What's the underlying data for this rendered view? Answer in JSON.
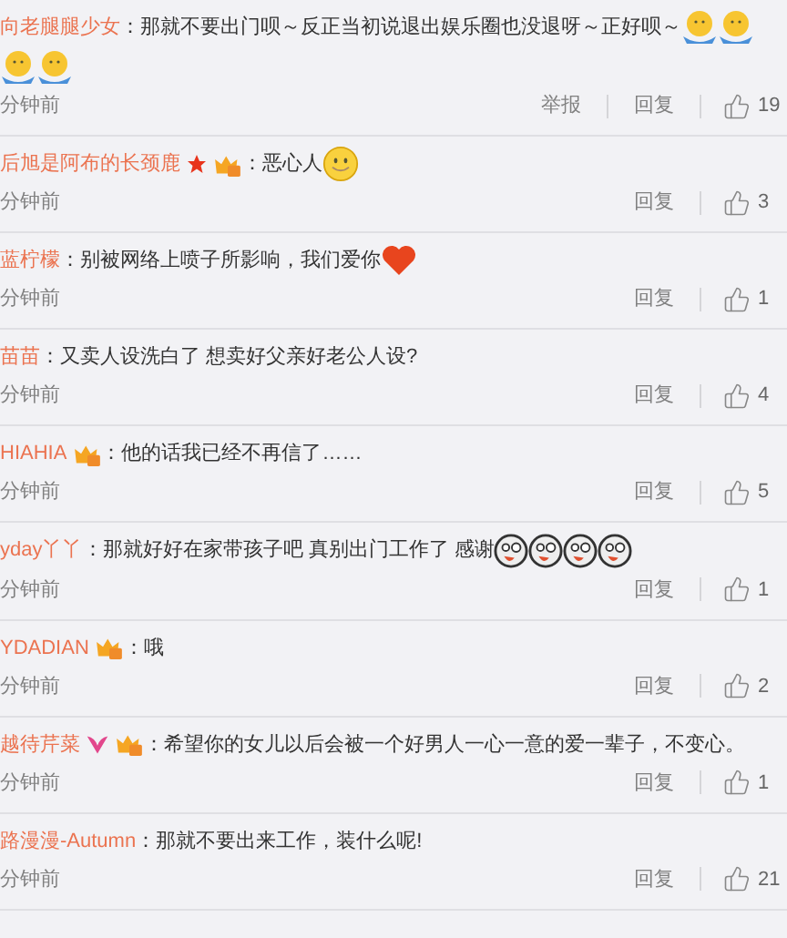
{
  "comments": [
    {
      "user": "向老腿腿少女",
      "colon": "：",
      "text": "那就不要出门呗～反正当初说退出娱乐圈也没退呀～正好呗～",
      "emojis": [
        {
          "kind": "shrug"
        },
        {
          "kind": "shrug"
        },
        {
          "kind": "shrug"
        },
        {
          "kind": "shrug"
        }
      ],
      "time": "分钟前",
      "actions": [
        "举报",
        "回复"
      ],
      "likes": "19"
    },
    {
      "user": "后旭是阿布的长颈鹿",
      "badges": [
        {
          "kind": "star"
        },
        {
          "kind": "vip"
        }
      ],
      "colon": "：",
      "text": "恶心人",
      "emojis": [
        {
          "kind": "smile"
        }
      ],
      "time": "分钟前",
      "actions": [
        "回复"
      ],
      "likes": "3"
    },
    {
      "user": "蓝柠檬",
      "colon": "：",
      "text": "别被网络上喷子所影响，我们爱你",
      "emojis": [
        {
          "kind": "heart"
        }
      ],
      "time": "分钟前",
      "actions": [
        "回复"
      ],
      "likes": "1"
    },
    {
      "user": "苗苗",
      "colon": "：",
      "text": "又卖人设洗白了 想卖好父亲好老公人设?",
      "time": "分钟前",
      "actions": [
        "回复"
      ],
      "likes": "4"
    },
    {
      "user": "HIAHIA",
      "badges": [
        {
          "kind": "vip"
        }
      ],
      "colon": "：",
      "text": "他的话我已经不再信了……",
      "time": "分钟前",
      "actions": [
        "回复"
      ],
      "likes": "5"
    },
    {
      "user": "yday丫丫",
      "colon": "：",
      "text": "那就好好在家带孩子吧 真别出门工作了 感谢",
      "emojis": [
        {
          "kind": "doge"
        },
        {
          "kind": "doge"
        },
        {
          "kind": "doge"
        },
        {
          "kind": "doge"
        }
      ],
      "time": "分钟前",
      "actions": [
        "回复"
      ],
      "likes": "1"
    },
    {
      "user": "YDADIAN",
      "badges": [
        {
          "kind": "vip"
        }
      ],
      "colon": "：",
      "text": "哦",
      "time": "分钟前",
      "actions": [
        "回复"
      ],
      "likes": "2"
    },
    {
      "user": "越待芹菜",
      "badges": [
        {
          "kind": "butterfly"
        },
        {
          "kind": "vip"
        }
      ],
      "colon": "：",
      "text": "希望你的女儿以后会被一个好男人一心一意的爱一辈子，不变心。",
      "time": "分钟前",
      "actions": [
        "回复"
      ],
      "likes": "1"
    },
    {
      "user": "路漫漫-Autumn",
      "colon": "：",
      "text": "那就不要出来工作，装什么呢!",
      "time": "分钟前",
      "actions": [
        "回复"
      ],
      "likes": "21"
    }
  ]
}
